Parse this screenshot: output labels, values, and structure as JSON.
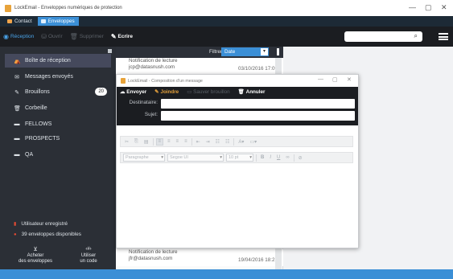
{
  "window": {
    "title": "LockEmail - Enveloppes numériques de protection",
    "controls": [
      "—",
      "▢",
      "✕"
    ]
  },
  "tabs": [
    {
      "label": "Contact",
      "icon": "contact-icon",
      "active": false
    },
    {
      "label": "Enveloppes",
      "icon": "envelope-icon",
      "active": true
    }
  ],
  "toolbar": {
    "reception": "Réception",
    "ouvrir": "Ouvrir",
    "supprimer": "Supprimer",
    "ecrire": "Ecrire"
  },
  "sidebar": {
    "items": [
      {
        "label": "Boîte de réception",
        "icon": "inbox-icon",
        "active": true
      },
      {
        "label": "Messages envoyés",
        "icon": "sent-icon"
      },
      {
        "label": "Brouillons",
        "icon": "pencil-icon",
        "badge": "20"
      },
      {
        "label": "Corbeille",
        "icon": "trash-icon"
      },
      {
        "label": "FELLOWS",
        "icon": "folder-icon"
      },
      {
        "label": "PROSPECTS",
        "icon": "folder-icon"
      },
      {
        "label": "QA",
        "icon": "folder-icon"
      }
    ],
    "user_status": "Utilisateur enregistré",
    "envelopes": "39 enveloppes disponibles",
    "buy": [
      "Acheter",
      "des enveloppes"
    ],
    "use": [
      "Utiliser",
      "un code"
    ]
  },
  "list": {
    "filter_label": "Filtrer par:",
    "filter_value": "Date",
    "messages": [
      {
        "subject": "Notification de lecture",
        "from": "jcp@datasnush.com",
        "date": "03/10/2016 17:09"
      },
      {
        "subject": "Notification de lecture",
        "from": "jfr@datasnush.com",
        "date": "19/04/2016 18:21"
      }
    ]
  },
  "compose": {
    "title": "LockEmail - Composition d'un message",
    "controls": [
      "—",
      "▢",
      "✕"
    ],
    "send": "Envoyer",
    "attach": "Joindre",
    "save_draft": "Sauver brouillon",
    "cancel": "Annuler",
    "to_label": "Destinataire:",
    "subject_label": "Sujet:",
    "to_value": "",
    "subject_value": "",
    "format_paragraph": "Paragraphe",
    "font_name": "Segoe UI",
    "font_size": "10 pt"
  },
  "colors": {
    "accent": "#3b8fd6",
    "dark_bar": "#1b1d21",
    "sidebar_bg": "#2b2f36",
    "orange": "#e3a03c",
    "red": "#e24a33"
  }
}
